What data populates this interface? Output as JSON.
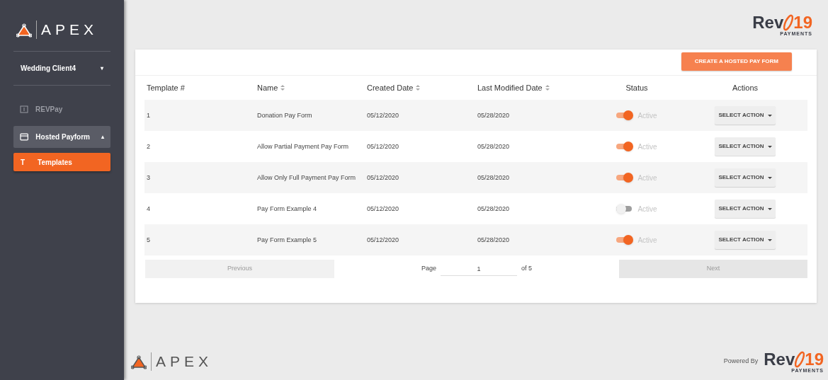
{
  "sidebar": {
    "logo": {
      "text": "APEX"
    },
    "client_select": {
      "value": "Wedding Client4",
      "caret": "▾"
    },
    "items": [
      {
        "kind": "link",
        "label": "REVPay",
        "selected": false
      },
      {
        "kind": "group",
        "label": "Hosted Payform",
        "caret": "▴",
        "expanded": true,
        "selected": false,
        "children": [
          {
            "icon_text": "T",
            "label": "Templates",
            "selected": true
          }
        ]
      }
    ]
  },
  "header": {
    "logo": {
      "brand": "Rev",
      "number": "19",
      "tagline": "PAYMENTS"
    }
  },
  "card": {
    "create_button": "CREATE A HOSTED PAY FORM",
    "table": {
      "columns": [
        {
          "label": "Template #",
          "sortable": false
        },
        {
          "label": "Name",
          "sortable": true
        },
        {
          "label": "Created Date",
          "sortable": true
        },
        {
          "label": "Last Modified Date",
          "sortable": true
        },
        {
          "label": "Status",
          "sortable": false
        },
        {
          "label": "Actions",
          "sortable": false
        }
      ],
      "rows": [
        {
          "number": "1",
          "name": "Donation Pay Form",
          "created": "05/12/2020",
          "modified": "05/28/2020",
          "on": true,
          "status": "Active",
          "action": "SELECT ACTION"
        },
        {
          "number": "2",
          "name": "Allow Partial Payment Pay Form",
          "created": "05/12/2020",
          "modified": "05/28/2020",
          "on": true,
          "status": "Active",
          "action": "SELECT ACTION"
        },
        {
          "number": "3",
          "name": "Allow Only Full Payment Pay Form",
          "created": "05/12/2020",
          "modified": "05/28/2020",
          "on": true,
          "status": "Active",
          "action": "SELECT ACTION"
        },
        {
          "number": "4",
          "name": "Pay Form Example 4",
          "created": "05/12/2020",
          "modified": "05/28/2020",
          "on": false,
          "status": "Active",
          "action": "SELECT ACTION"
        },
        {
          "number": "5",
          "name": "Pay Form Example 5",
          "created": "05/12/2020",
          "modified": "05/28/2020",
          "on": true,
          "status": "Active",
          "action": "SELECT ACTION"
        }
      ]
    },
    "pagination": {
      "previous": "Previous",
      "page_label": "Page",
      "page": "1",
      "of": "of 5",
      "next": "Next"
    }
  },
  "footer": {
    "logo": {
      "text": "APEX"
    },
    "powered_by": "Powered By",
    "rev_logo": {
      "brand": "Rev",
      "number": "19",
      "tagline": "PAYMENTS"
    }
  }
}
